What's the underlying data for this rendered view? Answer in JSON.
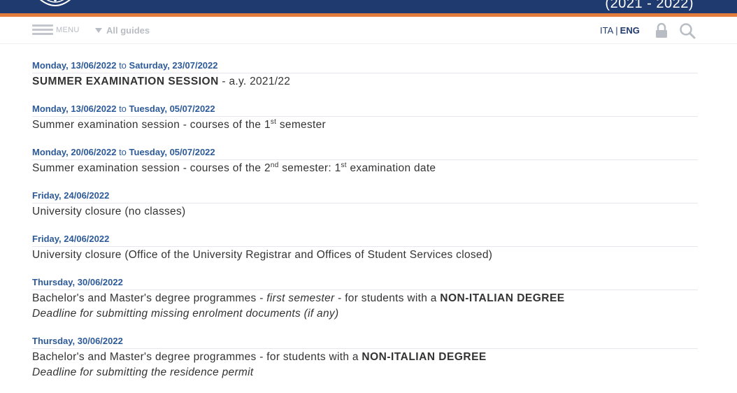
{
  "header": {
    "years": "(2021 - 2022)"
  },
  "nav": {
    "menu_label": "MENU",
    "guides_label": "All guides",
    "lang_ita": "ITA",
    "lang_sep": "|",
    "lang_eng": "ENG"
  },
  "events": [
    {
      "from": "Monday, 13/06/2022",
      "to_word": "to",
      "to": "Saturday, 23/07/2022",
      "title_bold": "SUMMER EXAMINATION SESSION",
      "title_rest": " - a.y. 2021/22"
    },
    {
      "from": "Monday, 13/06/2022",
      "to_word": "to",
      "to": "Tuesday, 05/07/2022",
      "text_a": "Summer examination session - courses of the 1",
      "sup_a": "st",
      "text_b": " semester"
    },
    {
      "from": "Monday, 20/06/2022",
      "to_word": "to",
      "to": "Tuesday, 05/07/2022",
      "text_a": "Summer examination session - courses of the 2",
      "sup_a": "nd",
      "text_b": " semester: 1",
      "sup_b": "st",
      "text_c": " examination date"
    },
    {
      "from": "Friday, 24/06/2022",
      "text": "University closure (no classes)"
    },
    {
      "from": "Friday, 24/06/2022",
      "text": "University closure (Office of the University Registrar and Offices of Student Services closed)"
    },
    {
      "from": "Thursday, 30/06/2022",
      "text_a": "Bachelor's and Master's degree programmes - ",
      "italic_a": "first semester",
      "text_b": " - for students with a ",
      "bold": "NON-ITALIAN DEGREE",
      "line2": "Deadline for submitting missing enrolment documents (if any)"
    },
    {
      "from": "Thursday, 30/06/2022",
      "text_a": "Bachelor's and Master's degree programmes - for students with a ",
      "bold": "NON-ITALIAN DEGREE",
      "line2": "Deadline for submitting the residence permit"
    }
  ]
}
